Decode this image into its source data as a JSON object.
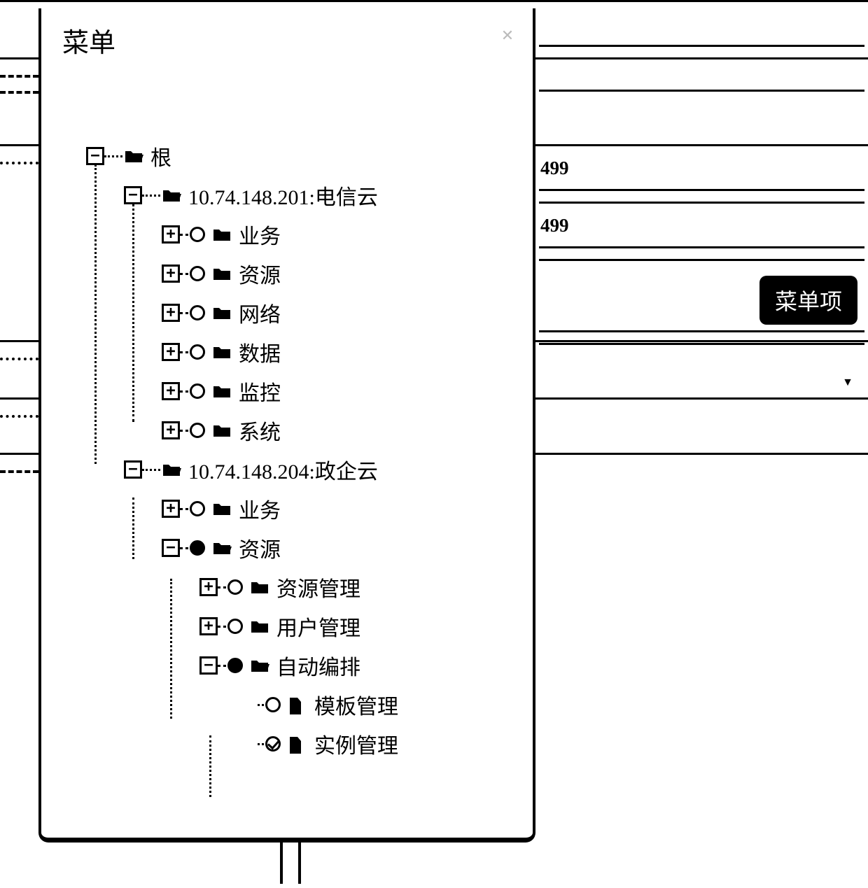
{
  "modal_title": "菜单",
  "tree": {
    "root": "根",
    "cloud1": {
      "ip": "10.74.148.201:",
      "name": "电信云",
      "children": [
        "业务",
        "资源",
        "网络",
        "数据",
        "监控",
        "系统"
      ]
    },
    "cloud2": {
      "ip": "10.74.148.204:",
      "name": "政企云",
      "children": {
        "biz": "业务",
        "res": {
          "label": "资源",
          "children": {
            "res_mgmt": "资源管理",
            "user_mgmt": "用户管理",
            "auto": {
              "label": "自动编排",
              "children": {
                "tpl": "模板管理",
                "inst": "实例管理"
              }
            }
          }
        }
      }
    }
  },
  "right": {
    "val1": "499",
    "val2": "499",
    "badge": "菜单项"
  }
}
